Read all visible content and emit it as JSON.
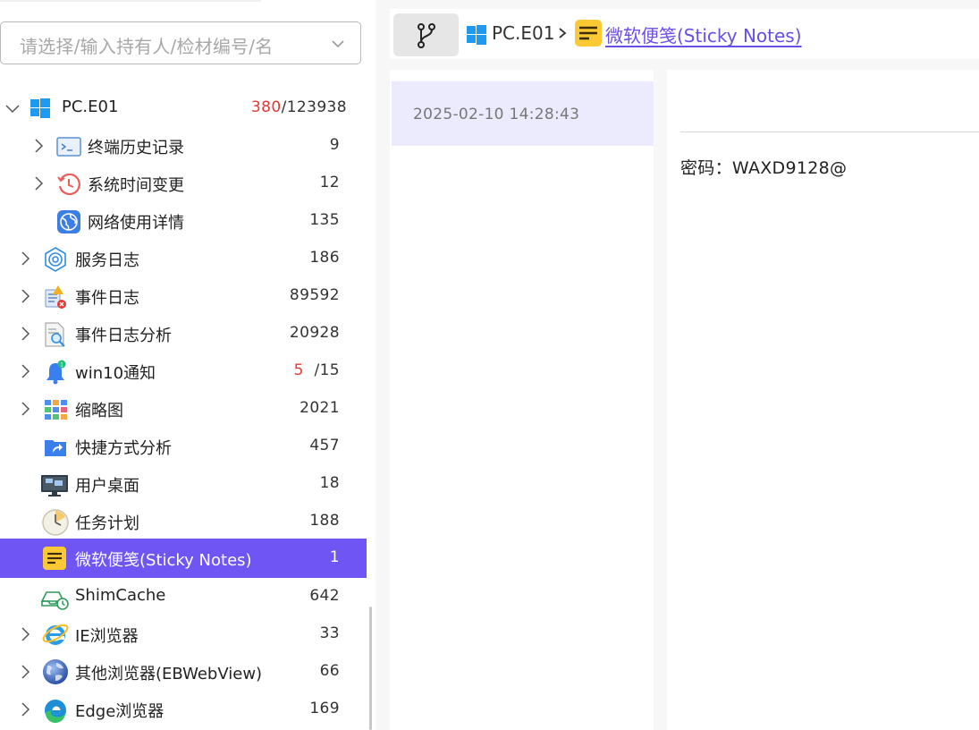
{
  "search": {
    "placeholder": "请选择/输入持有人/检材编号/名"
  },
  "tree": {
    "root": {
      "label": "PC.E01",
      "count_highlight": "380",
      "count_total": "/123938"
    },
    "items": [
      {
        "label": "终端历史记录",
        "count": "9",
        "icon": "terminal-icon"
      },
      {
        "label": "系统时间变更",
        "count": "12",
        "icon": "clock-history-icon"
      },
      {
        "label": "网络使用详情",
        "count": "135",
        "icon": "globe-icon"
      },
      {
        "label": "服务日志",
        "count": "186",
        "icon": "service-gear-icon"
      },
      {
        "label": "事件日志",
        "count": "89592",
        "icon": "event-log-icon"
      },
      {
        "label": "事件日志分析",
        "count": "20928",
        "icon": "log-analysis-icon"
      },
      {
        "label": "win10通知",
        "count_highlight": "5",
        "count_total": "/15",
        "icon": "bell-icon"
      },
      {
        "label": "缩略图",
        "count": "2021",
        "icon": "thumbnail-grid-icon"
      },
      {
        "label": "快捷方式分析",
        "count": "457",
        "icon": "shortcut-folder-icon"
      },
      {
        "label": "用户桌面",
        "count": "18",
        "icon": "monitor-icon"
      },
      {
        "label": "任务计划",
        "count": "188",
        "icon": "task-clock-icon"
      },
      {
        "label": "微软便笺(Sticky Notes)",
        "count": "1",
        "icon": "sticky-note-icon"
      },
      {
        "label": "ShimCache",
        "count": "642",
        "icon": "shimcache-icon"
      },
      {
        "label": "IE浏览器",
        "count": "33",
        "icon": "ie-browser-icon"
      },
      {
        "label": "其他浏览器(EBWebView)",
        "count": "66",
        "icon": "globe-browser-icon"
      },
      {
        "label": "Edge浏览器",
        "count": "169",
        "icon": "edge-browser-icon"
      }
    ]
  },
  "breadcrumb": {
    "root": "PC.E01",
    "separator": ">",
    "current": "微软便笺(Sticky Notes)"
  },
  "list": {
    "items": [
      {
        "timestamp": "2025-02-10 14:28:43"
      }
    ]
  },
  "detail": {
    "content": "密码：WAXD9128@"
  },
  "colors": {
    "accent": "#7055f5",
    "highlight_count": "#e53935",
    "link": "#6a4ee8",
    "list_selected": "#ecebfd"
  }
}
